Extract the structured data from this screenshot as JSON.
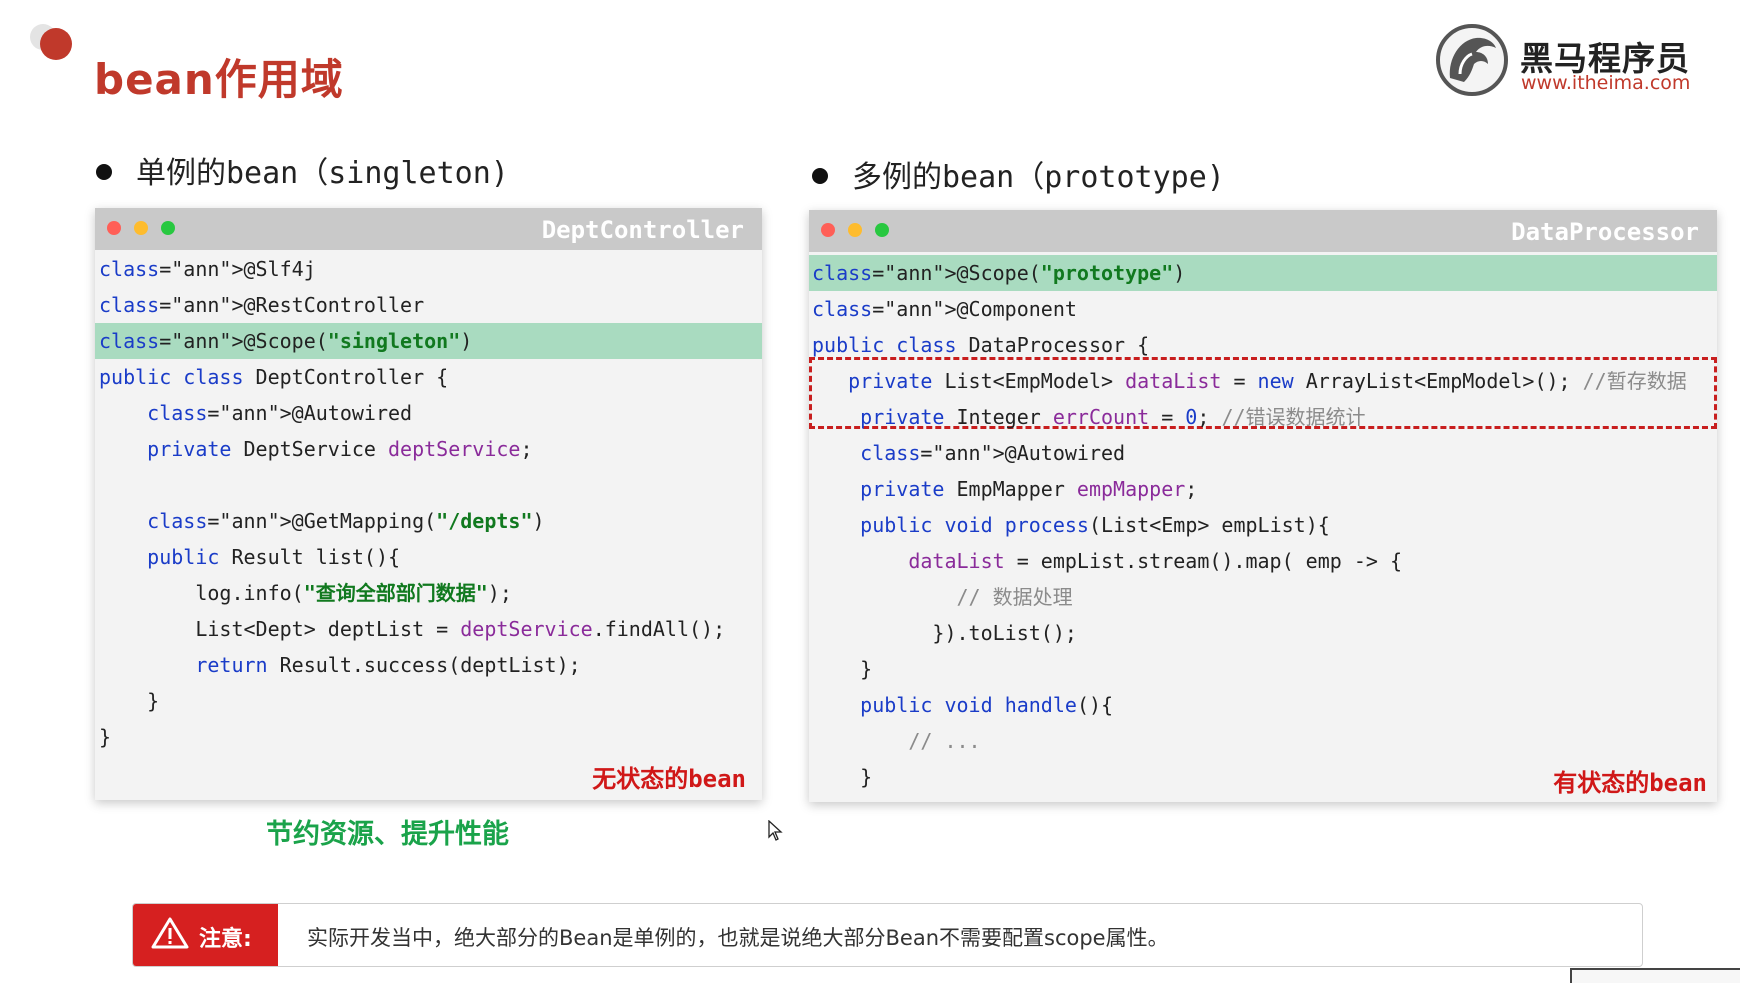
{
  "slide": {
    "title": "bean作用域",
    "logo": {
      "name": "黑马程序员",
      "url": "www.itheima.com"
    }
  },
  "left": {
    "heading": "单例的bean（singleton)",
    "window_title": "DeptController",
    "code": [
      "@Slf4j",
      "@RestController",
      "@Scope(\"singleton\")",
      "public class DeptController {",
      "    @Autowired",
      "    private DeptService deptService;",
      "",
      "    @GetMapping(\"/depts\")",
      "    public Result list(){",
      "        log.info(\"查询全部部门数据\");",
      "        List<Dept> deptList = deptService.findAll();",
      "        return Result.success(deptList);",
      "    }",
      "}"
    ],
    "state_label": "无状态的bean",
    "note": "节约资源、提升性能"
  },
  "right": {
    "heading": "多例的bean（prototype)",
    "window_title": "DataProcessor",
    "code": [
      "@Scope(\"prototype\")",
      "@Component",
      "public class DataProcessor {",
      "   private List<EmpModel> dataList = new ArrayList<EmpModel>(); //暂存数据",
      "    private Integer errCount = 0; //错误数据统计",
      "    @Autowired",
      "    private EmpMapper empMapper;",
      "    public void process(List<Emp> empList){",
      "        dataList = empList.stream().map( emp -> {",
      "            // 数据处理",
      "          }).toList();",
      "    }",
      "    public void handle(){",
      "        // ...",
      "    }"
    ],
    "state_label": "有状态的bean"
  },
  "notice": {
    "tag": "注意:",
    "text": "实际开发当中，绝大部分的Bean是单例的，也就是说绝大部分Bean不需要配置scope属性。"
  },
  "colors": {
    "title_red": "#c0392b",
    "highlight_green": "#a9dbc0",
    "annotation": "#9b8400",
    "keyword": "#1a3cc8",
    "field": "#8a2b9a",
    "string": "#11791f",
    "comment": "#8b8b8b",
    "notice_red": "#d62020",
    "note_green": "#1aa34a"
  },
  "icons": [
    "warning-triangle-icon",
    "horse-logo-icon",
    "mouse-cursor-icon"
  ]
}
